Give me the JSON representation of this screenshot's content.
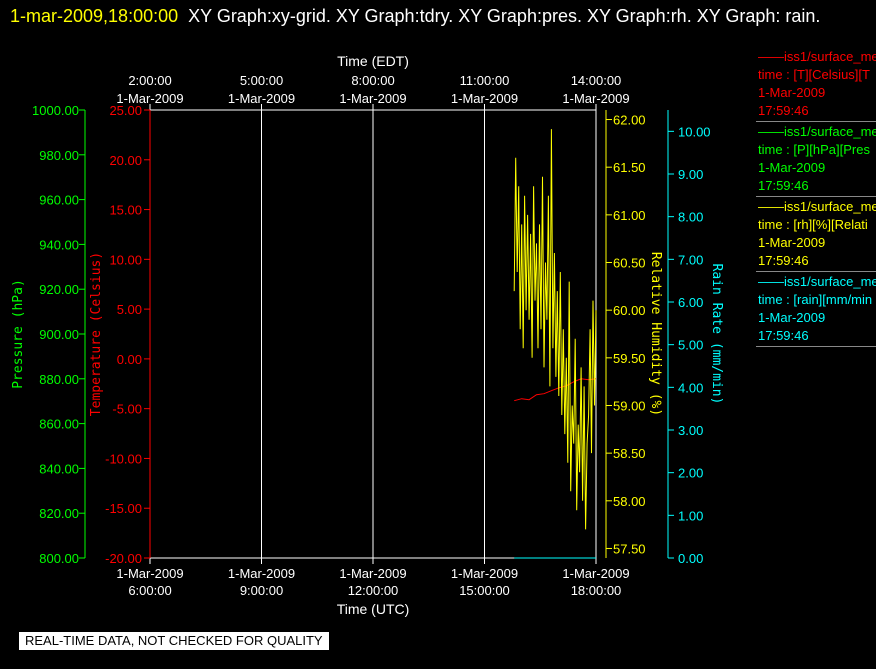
{
  "title": {
    "date": "1-mar-2009,18:00:00",
    "text": "XY Graph:xy-grid.  XY Graph:tdry.  XY Graph:pres.  XY Graph:rh.  XY Graph: rain."
  },
  "colors": {
    "background": "#000000",
    "temperature": "#ff0000",
    "pressure": "#00ff00",
    "humidity": "#ffff00",
    "rain": "#00ffff",
    "grid": "#ffffff"
  },
  "legend": [
    {
      "line1": "——iss1/surface_me",
      "line2": "time : [T][Celsius][T",
      "line3": "1-Mar-2009",
      "line4": "17:59:46",
      "color": "#ff0000"
    },
    {
      "line1": "——iss1/surface_me",
      "line2": "time : [P][hPa][Pres",
      "line3": "1-Mar-2009",
      "line4": "17:59:46",
      "color": "#00ff00"
    },
    {
      "line1": "——iss1/surface_me",
      "line2": "time : [rh][%][Relati",
      "line3": "1-Mar-2009",
      "line4": "17:59:46",
      "color": "#ffff00"
    },
    {
      "line1": "——iss1/surface_me",
      "line2": "time : [rain][mm/min",
      "line3": "1-Mar-2009",
      "line4": "17:59:46",
      "color": "#00ffff"
    }
  ],
  "quality_banner": "REAL-TIME DATA, NOT CHECKED FOR QUALITY",
  "chart_data": {
    "type": "line",
    "x_top": {
      "label": "Time (EDT)",
      "ticks": [
        {
          "time": "2:00:00",
          "date": "1-Mar-2009"
        },
        {
          "time": "5:00:00",
          "date": "1-Mar-2009"
        },
        {
          "time": "8:00:00",
          "date": "1-Mar-2009"
        },
        {
          "time": "11:00:00",
          "date": "1-Mar-2009"
        },
        {
          "time": "14:00:00",
          "date": "1-Mar-2009"
        }
      ]
    },
    "x_bottom": {
      "label": "Time (UTC)",
      "ticks": [
        {
          "time": "6:00:00",
          "date": "1-Mar-2009"
        },
        {
          "time": "9:00:00",
          "date": "1-Mar-2009"
        },
        {
          "time": "12:00:00",
          "date": "1-Mar-2009"
        },
        {
          "time": "15:00:00",
          "date": "1-Mar-2009"
        },
        {
          "time": "18:00:00",
          "date": "1-Mar-2009"
        }
      ],
      "range_hours_utc": [
        6,
        18
      ]
    },
    "axes": {
      "pressure": {
        "label": "Pressure (hPa)",
        "range": [
          800,
          1000
        ],
        "ticks": [
          "800.00",
          "820.00",
          "840.00",
          "860.00",
          "880.00",
          "900.00",
          "920.00",
          "940.00",
          "960.00",
          "980.00",
          "1000.00"
        ]
      },
      "temperature": {
        "label": "Temperature (Celsius)",
        "range": [
          -20,
          25
        ],
        "ticks": [
          "-20.00",
          "-15.00",
          "-10.00",
          "-5.00",
          "0.00",
          "5.00",
          "10.00",
          "15.00",
          "20.00",
          "25.00"
        ]
      },
      "humidity": {
        "label": "Relative Humidity (%)",
        "range": [
          57.4,
          62.1
        ],
        "ticks": [
          "57.50",
          "58.00",
          "58.50",
          "59.00",
          "59.50",
          "60.00",
          "60.50",
          "61.00",
          "61.50",
          "62.00"
        ]
      },
      "rain": {
        "label": "Rain Rate (mm/min)",
        "range": [
          0,
          10.5
        ],
        "ticks": [
          "0.00",
          "1.00",
          "2.00",
          "3.00",
          "4.00",
          "5.00",
          "6.00",
          "7.00",
          "8.00",
          "9.00",
          "10.00"
        ]
      }
    },
    "grid": true,
    "series": [
      {
        "name": "Temperature",
        "axis": "temperature",
        "x_hours_utc": [
          15.8,
          16.0,
          16.2,
          16.4,
          16.6,
          16.8,
          17.0,
          17.2,
          17.4,
          17.6,
          17.8,
          18.0
        ],
        "values": [
          -4.2,
          -4.0,
          -4.1,
          -3.6,
          -3.5,
          -3.2,
          -2.9,
          -2.7,
          -2.3,
          -2.0,
          -2.1,
          -2.0
        ]
      },
      {
        "name": "Relative Humidity",
        "axis": "humidity",
        "x_hours_utc": [
          15.8,
          15.84,
          15.88,
          15.92,
          15.96,
          16.0,
          16.04,
          16.08,
          16.12,
          16.16,
          16.2,
          16.24,
          16.28,
          16.32,
          16.36,
          16.4,
          16.44,
          16.48,
          16.52,
          16.56,
          16.6,
          16.64,
          16.68,
          16.72,
          16.76,
          16.8,
          16.84,
          16.88,
          16.92,
          16.96,
          17.0,
          17.04,
          17.08,
          17.12,
          17.16,
          17.2,
          17.24,
          17.28,
          17.32,
          17.36,
          17.4,
          17.44,
          17.48,
          17.52,
          17.56,
          17.6,
          17.64,
          17.68,
          17.72,
          17.76,
          17.8,
          17.84,
          17.88,
          17.92,
          17.96,
          18.0
        ],
        "values": [
          60.2,
          61.6,
          60.4,
          61.3,
          59.8,
          60.9,
          59.6,
          61.2,
          60.0,
          61.0,
          59.9,
          60.8,
          59.5,
          61.3,
          60.1,
          60.7,
          59.6,
          60.9,
          59.8,
          61.4,
          59.4,
          60.5,
          59.9,
          61.2,
          59.2,
          61.9,
          59.6,
          60.6,
          59.3,
          60.2,
          59.1,
          60.4,
          58.9,
          59.8,
          58.7,
          59.5,
          58.4,
          60.3,
          58.1,
          59.0,
          58.6,
          59.7,
          57.9,
          58.8,
          58.3,
          59.4,
          58.0,
          59.2,
          57.7,
          58.6,
          58.9,
          59.8,
          58.5,
          60.1,
          59.0,
          60.0
        ]
      },
      {
        "name": "Rain Rate",
        "axis": "rain",
        "x_hours_utc": [
          15.8,
          18.0
        ],
        "values": [
          0.0,
          0.0
        ]
      }
    ]
  }
}
